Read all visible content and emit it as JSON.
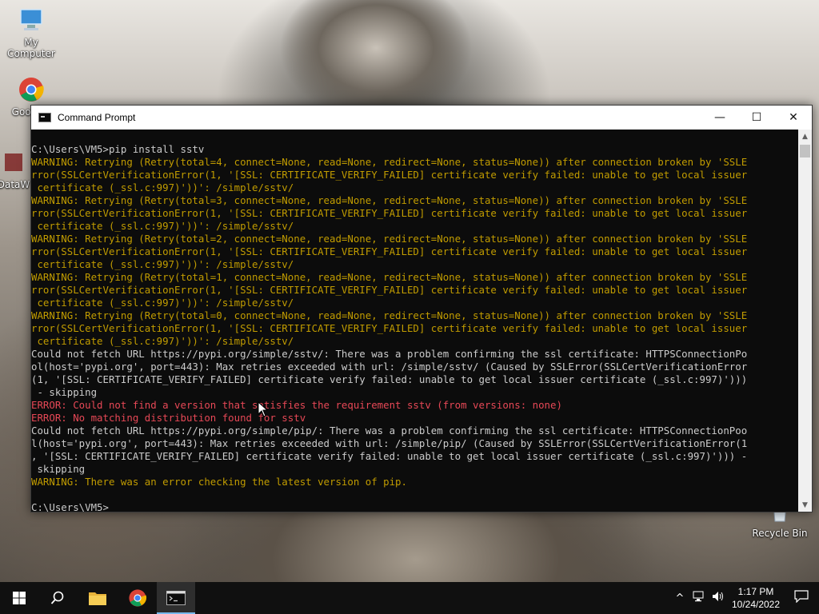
{
  "desktop": {
    "icons": [
      {
        "label": "My Computer",
        "icon": "computer-icon"
      },
      {
        "label": "Goo Chr",
        "icon": "chrome-icon"
      },
      {
        "label": "DataW",
        "icon": "app-icon"
      },
      {
        "label": "Recycle Bin",
        "icon": "recycle-bin-icon"
      }
    ]
  },
  "window": {
    "title": "Command Prompt",
    "buttons": {
      "minimize": "—",
      "maximize": "☐",
      "close": "✕"
    },
    "lines": [
      {
        "text": "C:\\Users\\VM5>pip install sstv",
        "style": "n"
      },
      {
        "text": "WARNING: Retrying (Retry(total=4, connect=None, read=None, redirect=None, status=None)) after connection broken by 'SSLE",
        "style": "w"
      },
      {
        "text": "rror(SSLCertVerificationError(1, '[SSL: CERTIFICATE_VERIFY_FAILED] certificate verify failed: unable to get local issuer",
        "style": "w"
      },
      {
        "text": " certificate (_ssl.c:997)'))': /simple/sstv/",
        "style": "w"
      },
      {
        "text": "WARNING: Retrying (Retry(total=3, connect=None, read=None, redirect=None, status=None)) after connection broken by 'SSLE",
        "style": "w"
      },
      {
        "text": "rror(SSLCertVerificationError(1, '[SSL: CERTIFICATE_VERIFY_FAILED] certificate verify failed: unable to get local issuer",
        "style": "w"
      },
      {
        "text": " certificate (_ssl.c:997)'))': /simple/sstv/",
        "style": "w"
      },
      {
        "text": "WARNING: Retrying (Retry(total=2, connect=None, read=None, redirect=None, status=None)) after connection broken by 'SSLE",
        "style": "w"
      },
      {
        "text": "rror(SSLCertVerificationError(1, '[SSL: CERTIFICATE_VERIFY_FAILED] certificate verify failed: unable to get local issuer",
        "style": "w"
      },
      {
        "text": " certificate (_ssl.c:997)'))': /simple/sstv/",
        "style": "w"
      },
      {
        "text": "WARNING: Retrying (Retry(total=1, connect=None, read=None, redirect=None, status=None)) after connection broken by 'SSLE",
        "style": "w"
      },
      {
        "text": "rror(SSLCertVerificationError(1, '[SSL: CERTIFICATE_VERIFY_FAILED] certificate verify failed: unable to get local issuer",
        "style": "w"
      },
      {
        "text": " certificate (_ssl.c:997)'))': /simple/sstv/",
        "style": "w"
      },
      {
        "text": "WARNING: Retrying (Retry(total=0, connect=None, read=None, redirect=None, status=None)) after connection broken by 'SSLE",
        "style": "w"
      },
      {
        "text": "rror(SSLCertVerificationError(1, '[SSL: CERTIFICATE_VERIFY_FAILED] certificate verify failed: unable to get local issuer",
        "style": "w"
      },
      {
        "text": " certificate (_ssl.c:997)'))': /simple/sstv/",
        "style": "w"
      },
      {
        "text": "Could not fetch URL https://pypi.org/simple/sstv/: There was a problem confirming the ssl certificate: HTTPSConnectionPo",
        "style": "n"
      },
      {
        "text": "ol(host='pypi.org', port=443): Max retries exceeded with url: /simple/sstv/ (Caused by SSLError(SSLCertVerificationError",
        "style": "n"
      },
      {
        "text": "(1, '[SSL: CERTIFICATE_VERIFY_FAILED] certificate verify failed: unable to get local issuer certificate (_ssl.c:997)')))",
        "style": "n"
      },
      {
        "text": " - skipping",
        "style": "n"
      },
      {
        "text": "ERROR: Could not find a version that satisfies the requirement sstv (from versions: none)",
        "style": "e"
      },
      {
        "text": "ERROR: No matching distribution found for sstv",
        "style": "e"
      },
      {
        "text": "Could not fetch URL https://pypi.org/simple/pip/: There was a problem confirming the ssl certificate: HTTPSConnectionPoo",
        "style": "n"
      },
      {
        "text": "l(host='pypi.org', port=443): Max retries exceeded with url: /simple/pip/ (Caused by SSLError(SSLCertVerificationError(1",
        "style": "n"
      },
      {
        "text": ", '[SSL: CERTIFICATE_VERIFY_FAILED] certificate verify failed: unable to get local issuer certificate (_ssl.c:997)'))) -",
        "style": "n"
      },
      {
        "text": " skipping",
        "style": "n"
      },
      {
        "text": "WARNING: There was an error checking the latest version of pip.",
        "style": "w"
      },
      {
        "text": "",
        "style": "n"
      },
      {
        "text": "C:\\Users\\VM5>",
        "style": "n"
      }
    ]
  },
  "taskbar": {
    "items": [
      {
        "name": "start-button",
        "icon": "windows-icon"
      },
      {
        "name": "search-button",
        "icon": "search-icon"
      },
      {
        "name": "file-explorer-button",
        "icon": "folder-icon"
      },
      {
        "name": "chrome-button",
        "icon": "chrome-icon"
      },
      {
        "name": "command-prompt-button",
        "icon": "cmd-icon",
        "active": true
      }
    ],
    "tray": {
      "chevron": "^",
      "time": "1:17 PM",
      "date": "10/24/2022"
    }
  },
  "colors": {
    "warning": "#c19c00",
    "error": "#e74856",
    "text": "#cccccc",
    "console_bg": "#0c0c0c",
    "taskbar_bg": "#101010",
    "active_accent": "#76b9ed"
  }
}
